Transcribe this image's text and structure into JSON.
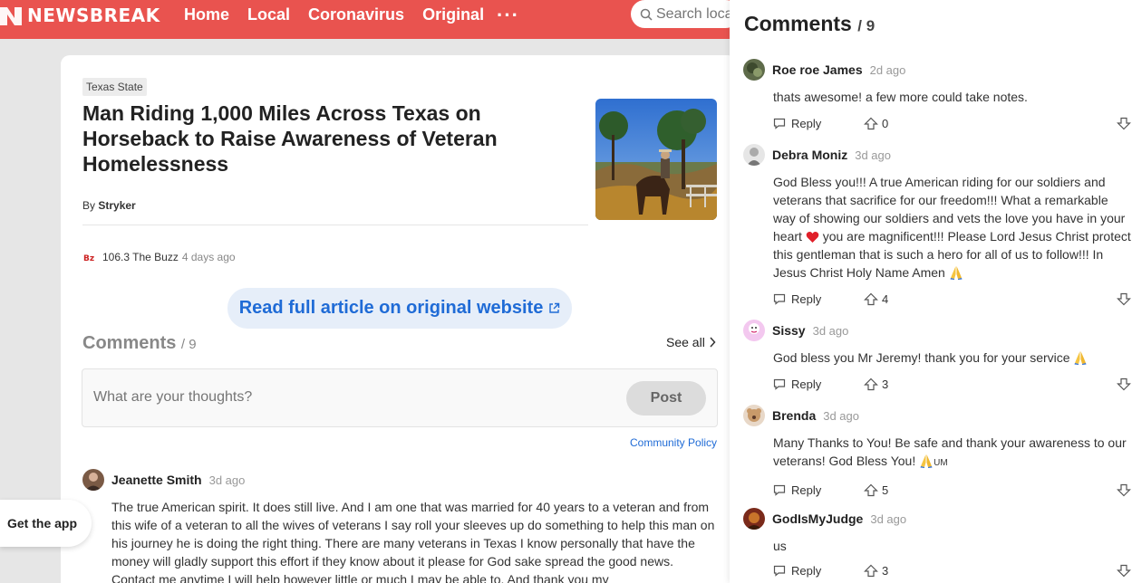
{
  "header": {
    "logo_text": "NEWSBREAK",
    "nav": [
      "Home",
      "Local",
      "Coronavirus",
      "Original"
    ],
    "more": "···",
    "search_placeholder": "Search local"
  },
  "article": {
    "tag": "Texas State",
    "title": "Man Riding 1,000 Miles Across Texas on Horseback to Raise Awareness of Veteran Homelessness",
    "byline_prefix": "By ",
    "author": "Stryker",
    "source_name": "106.3 The Buzz",
    "source_time": "4 days ago",
    "read_full": "Read full article on original website",
    "comments_label": "Comments",
    "comments_count": "/ 9",
    "see_all": "See all",
    "input_placeholder": "What are your thoughts?",
    "post_label": "Post",
    "community_policy": "Community Policy",
    "top_comment": {
      "name": "Jeanette Smith",
      "time": "3d ago",
      "text": "The true American spirit. It does still live. And I am one that was married for 40 years to a veteran and from this wife of a veteran to all the wives of veterans I say roll your sleeves up do something to help this man on his journey he is doing the right thing. There are many veterans in Texas I know personally that have the money will gladly support this effort if they know about it please for God sake spread the good news. Contact me anytime I will help however little or much I may be able to. And thank you my"
    }
  },
  "get_app": "Get the app",
  "panel": {
    "title": "Comments",
    "count": "/ 9",
    "reply_label": "Reply",
    "comments": [
      {
        "name": "Roe roe James",
        "time": "2d ago",
        "text": "thats awesome! a few more could take notes.",
        "votes": "0"
      },
      {
        "name": "Debra Moniz",
        "time": "3d ago",
        "text": "God Bless you!!! A true American riding for our soldiers and veterans that sacrifice for our freedom!!! What a remarkable way of showing our soldiers and vets the love you have in your heart",
        "text2": " you are magnificent!!! Please Lord Jesus Christ protect this gentleman that is such a hero for all of us to follow!!! In Jesus Christ Holy Name Amen ",
        "votes": "4"
      },
      {
        "name": "Sissy",
        "time": "3d ago",
        "text": "God bless you Mr Jeremy! thank you for your service ",
        "votes": "3"
      },
      {
        "name": "Brenda",
        "time": "3d ago",
        "text": "Many Thanks to You! Be safe and thank your awareness to our veterans! God Bless You! ",
        "text2": "UM",
        "votes": "5"
      },
      {
        "name": "GodIsMyJudge",
        "time": "3d ago",
        "text": "us",
        "votes": "3"
      }
    ]
  },
  "colors": {
    "brand": "#e9534f",
    "link": "#1f6bd6"
  }
}
